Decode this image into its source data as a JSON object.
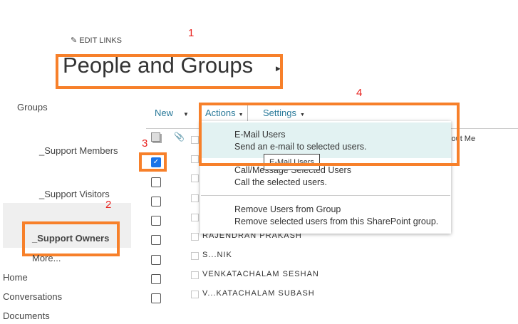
{
  "header": {
    "edit_links": "EDIT LINKS",
    "title": "People and Groups"
  },
  "annotations": [
    "1",
    "2",
    "3",
    "4"
  ],
  "sidebar": {
    "heading": "Groups",
    "groups": [
      "_Support Members",
      "_Support Visitors",
      "_Support Owners"
    ],
    "more": "More...",
    "links": [
      "Home",
      "Conversations",
      "Documents"
    ]
  },
  "toolbar": {
    "new": "New",
    "actions": "Actions",
    "settings": "Settings"
  },
  "list": {
    "column_about": "About Me",
    "names": [
      "RAJENDRAN PRAKASH",
      "S...NIK",
      "VENKATACHALAM SESHAN",
      "V...KATACHALAM SUBASH"
    ]
  },
  "menu": {
    "items": [
      {
        "title": "E-Mail Users",
        "desc": "Send an e-mail to selected users."
      },
      {
        "title": "Call/Message Selected Users",
        "desc": "Call the selected users."
      },
      {
        "title": "Remove Users from Group",
        "desc": "Remove selected users from this SharePoint group."
      }
    ],
    "tooltip": "E-Mail Users"
  },
  "colors": {
    "accent": "#f7802a",
    "highlight": "#e2f2f2",
    "link": "#2a7a9a"
  }
}
